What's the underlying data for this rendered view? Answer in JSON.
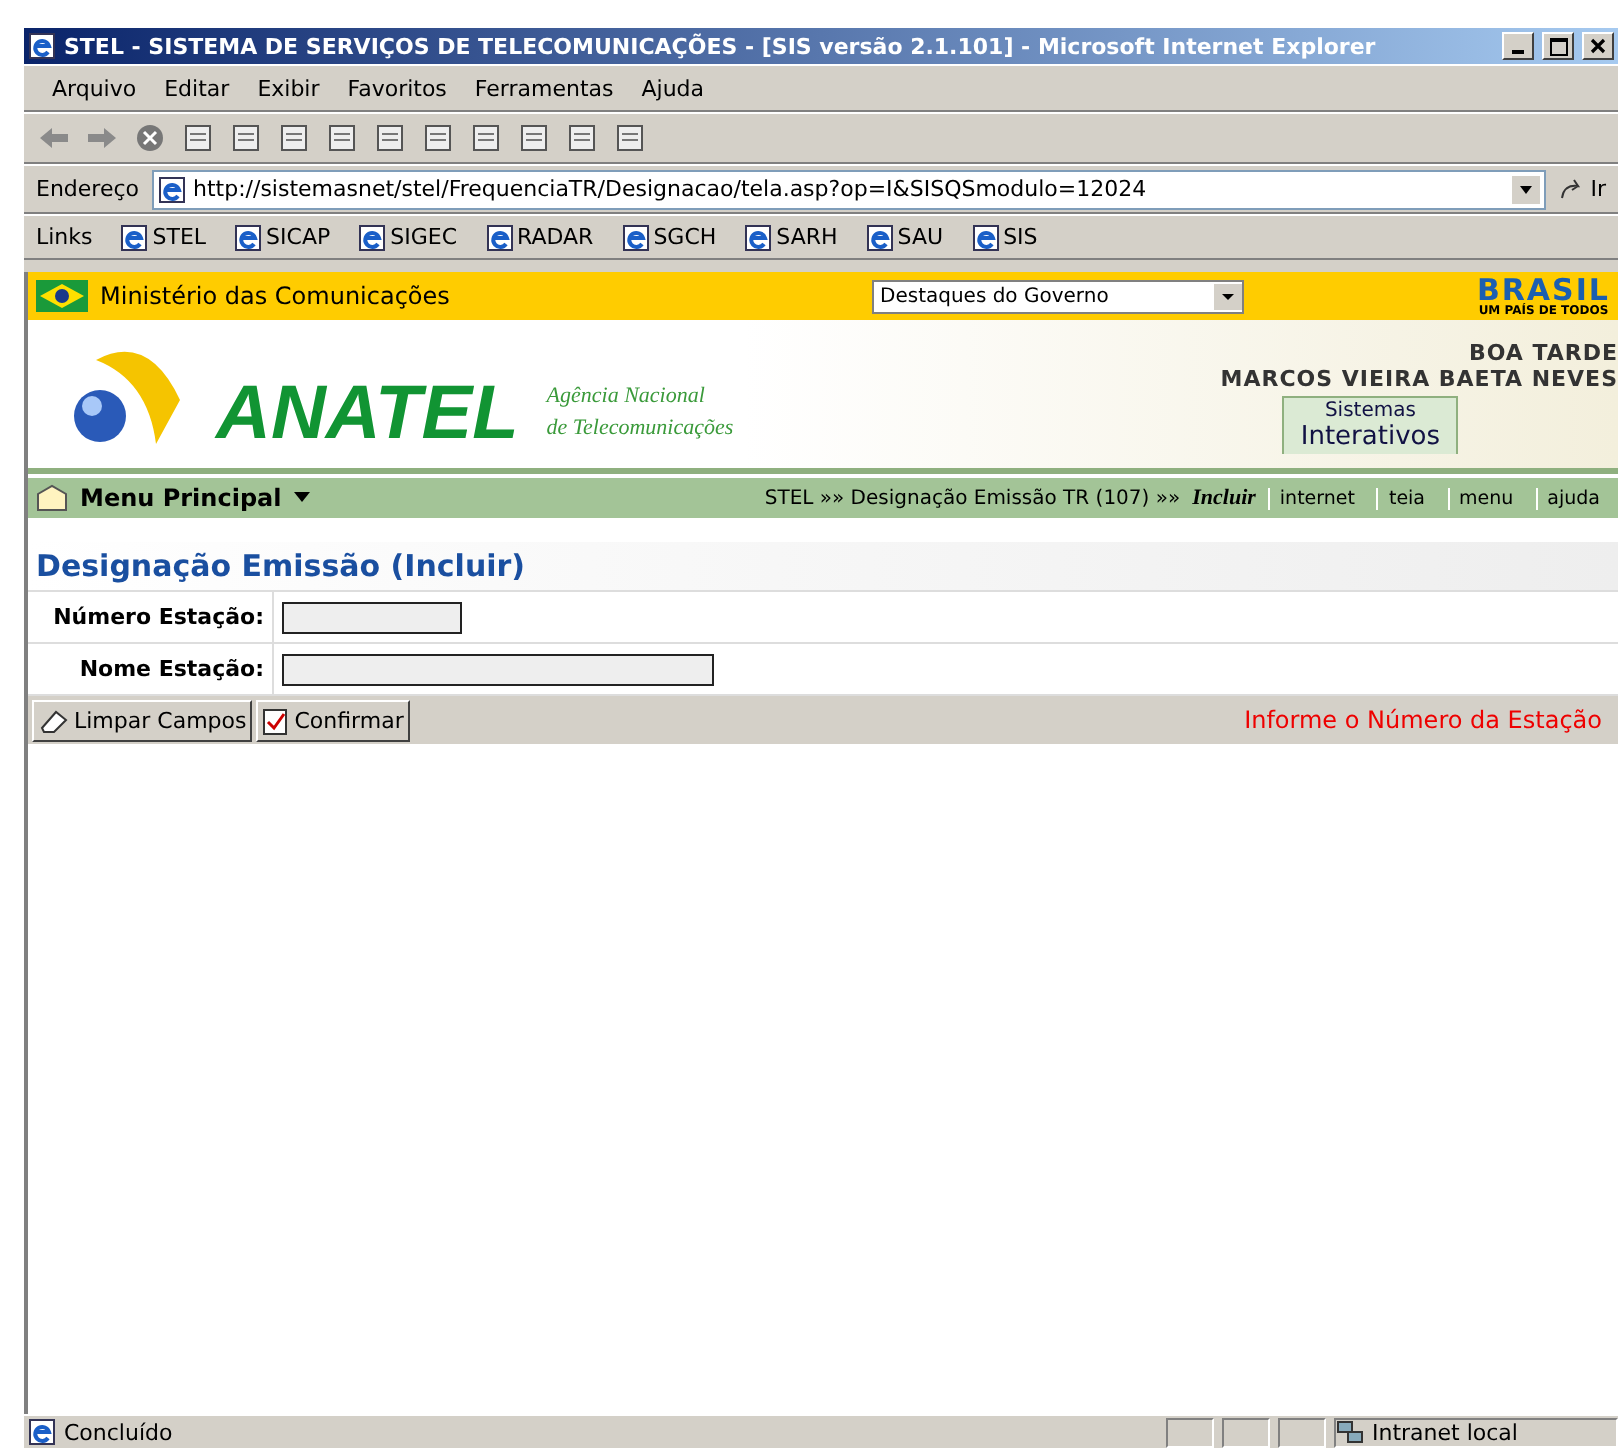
{
  "window": {
    "title": "STEL - SISTEMA DE SERVIÇOS DE TELECOMUNICAÇÕES - [SIS versão 2.1.101] - Microsoft Internet Explorer"
  },
  "menu": [
    "Arquivo",
    "Editar",
    "Exibir",
    "Favoritos",
    "Ferramentas",
    "Ajuda"
  ],
  "address": {
    "label": "Endereço",
    "url": "http://sistemasnet/stel/FrequenciaTR/Designacao/tela.asp?op=I&SISQSmodulo=12024",
    "go": "Ir"
  },
  "links": {
    "label": "Links",
    "items": [
      "STEL",
      "SICAP",
      "SIGEC",
      "RADAR",
      "SGCH",
      "SARH",
      "SAU",
      "SIS"
    ]
  },
  "gov_bar": {
    "ministry": "Ministério das Comunicações",
    "select": "Destaques do Governo",
    "brand": "BRASIL",
    "tagline": "UM PAÍS DE TODOS"
  },
  "header": {
    "logo": "ANATEL",
    "agency_line_1": "Agência Nacional",
    "agency_line_2": "de Telecomunicações",
    "greeting": "BOA TARDE",
    "user": "MARCOS VIEIRA BAETA NEVES",
    "tab_line_1": "Sistemas",
    "tab_line_2": "Interativos"
  },
  "nav": {
    "menu": "Menu Principal",
    "breadcrumb": "STEL »» Designação Emissão TR (107) »»",
    "current": "Incluir",
    "links": [
      "internet",
      "teia",
      "menu",
      "ajuda"
    ]
  },
  "form": {
    "title": "Designação Emissão (Incluir)",
    "fields": [
      {
        "label": "Número Estação:"
      },
      {
        "label": "Nome Estação:"
      }
    ],
    "buttons": [
      {
        "label": "Limpar Campos",
        "kind": "clear"
      },
      {
        "label": "Confirmar",
        "kind": "confirm"
      }
    ],
    "message": "Informe o Número da Estação"
  },
  "status_bar": {
    "text": "Concluído",
    "zone": "Intranet local"
  }
}
